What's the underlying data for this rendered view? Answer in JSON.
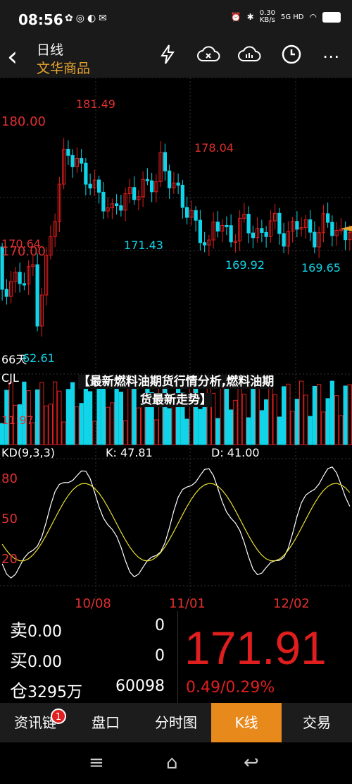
{
  "status_bar": {
    "time": "08:56",
    "speed": "0.30",
    "speed_unit": "KB/s",
    "network": "5G HD"
  },
  "header": {
    "line1": "日线",
    "line2": "文华商品"
  },
  "chart": {
    "y_labels": [
      "180.00",
      "170.64",
      "170.00",
      "66天"
    ],
    "annotations": [
      "181.49",
      "178.04",
      "171.43",
      "169.92",
      "169.65",
      "62.61"
    ],
    "cjl_label": "CJL",
    "cjl_value": "11.97",
    "kd_label": "KD(9,3,3)",
    "k_value": "K: 47.81",
    "d_value": "D: 41.00",
    "kd_levels": [
      "80",
      "50",
      "20"
    ],
    "dates": [
      "10/08",
      "11/01",
      "12/02"
    ]
  },
  "overlay_text": {
    "line1": "【最新燃料油期货行情分析,燃料油期",
    "line2": "货最新走势】"
  },
  "quote": {
    "sell_label": "卖",
    "sell_price": "0.00",
    "sell_qty": "0",
    "buy_label": "买",
    "buy_price": "0.00",
    "buy_qty": "0",
    "pos_label": "仓",
    "pos_value": "3295万",
    "pos_count": "60098",
    "last_price": "171.91",
    "change": "0.49/0.29%"
  },
  "tabs": [
    {
      "label": "资讯链",
      "badge": "1"
    },
    {
      "label": "盘口"
    },
    {
      "label": "分时图"
    },
    {
      "label": "K线"
    },
    {
      "label": "交易"
    }
  ],
  "colors": {
    "up": "#e01e1e",
    "down": "#11d4e8",
    "accent": "#e8891c"
  }
}
